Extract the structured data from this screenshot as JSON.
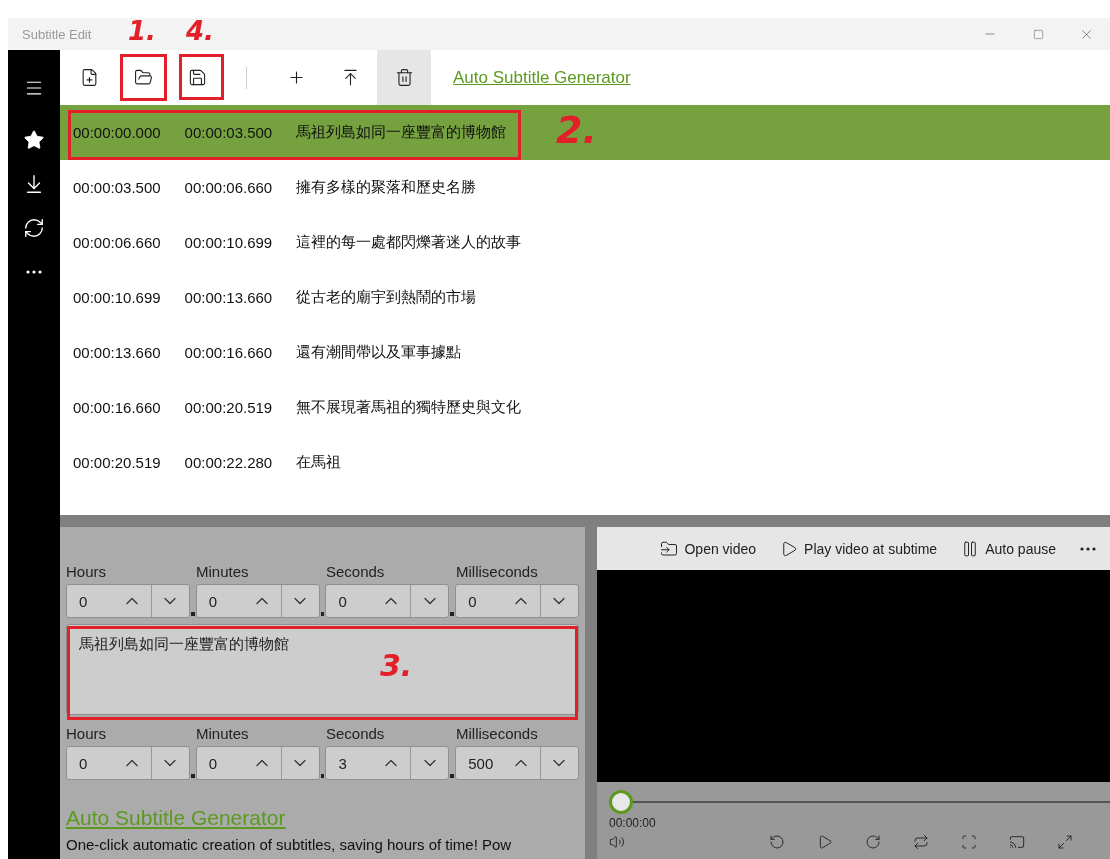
{
  "window": {
    "title": "Subtitle Edit"
  },
  "sidebar": {
    "items": [
      {
        "kind": "favorites"
      },
      {
        "kind": "download"
      },
      {
        "kind": "sync"
      },
      {
        "kind": "more"
      }
    ]
  },
  "toolbar": {
    "buttons": [
      {
        "kind": "new",
        "hovered": false
      },
      {
        "kind": "open",
        "hovered": false
      },
      {
        "kind": "save",
        "hovered": false
      },
      {
        "kind": "separator"
      },
      {
        "kind": "add",
        "hovered": false
      },
      {
        "kind": "insert-top",
        "hovered": false
      },
      {
        "kind": "delete",
        "hovered": true
      }
    ],
    "link": "Auto Subtitle Generator"
  },
  "subtitles": [
    {
      "start": "00:00:00.000",
      "end": "00:00:03.500",
      "text": "馬祖列島如同一座豐富的博物館",
      "selected": true
    },
    {
      "start": "00:00:03.500",
      "end": "00:00:06.660",
      "text": "擁有多樣的聚落和歷史名勝",
      "selected": false
    },
    {
      "start": "00:00:06.660",
      "end": "00:00:10.699",
      "text": "這裡的每一處都閃爍著迷人的故事",
      "selected": false
    },
    {
      "start": "00:00:10.699",
      "end": "00:00:13.660",
      "text": "從古老的廟宇到熱鬧的市場",
      "selected": false
    },
    {
      "start": "00:00:13.660",
      "end": "00:00:16.660",
      "text": "還有潮間帶以及軍事據點",
      "selected": false
    },
    {
      "start": "00:00:16.660",
      "end": "00:00:20.519",
      "text": "無不展現著馬祖的獨特歷史與文化",
      "selected": false
    },
    {
      "start": "00:00:20.519",
      "end": "00:00:22.280",
      "text": "在馬祖",
      "selected": false
    }
  ],
  "editor": {
    "start_time": [
      {
        "label": "Hours",
        "value": "0"
      },
      {
        "label": "Minutes",
        "value": "0"
      },
      {
        "label": "Seconds",
        "value": "0"
      },
      {
        "label": "Milliseconds",
        "value": "0"
      }
    ],
    "text": "馬祖列島如同一座豐富的博物館",
    "end_time": [
      {
        "label": "Hours",
        "value": "0"
      },
      {
        "label": "Minutes",
        "value": "0"
      },
      {
        "label": "Seconds",
        "value": "3"
      },
      {
        "label": "Milliseconds",
        "value": "500"
      }
    ]
  },
  "promo": {
    "link": "Auto Subtitle Generator",
    "description": "One-click automatic creation of subtitles, saving hours of time! Pow"
  },
  "video": {
    "toolbar": [
      {
        "kind": "open",
        "label": "Open video"
      },
      {
        "kind": "play",
        "label": "Play video at subtime"
      },
      {
        "kind": "pause",
        "label": "Auto pause"
      },
      {
        "kind": "more"
      }
    ],
    "position": {
      "level": 0,
      "time": "00:00:00"
    },
    "controls": [
      {
        "kind": "volume"
      },
      {
        "kind": "back"
      },
      {
        "kind": "play"
      },
      {
        "kind": "forward"
      },
      {
        "kind": "replay"
      },
      {
        "kind": "fit"
      },
      {
        "kind": "cast"
      },
      {
        "kind": "fullscreen"
      }
    ]
  },
  "annotations": [
    {
      "label": "1."
    },
    {
      "label": "4."
    },
    {
      "label": "2."
    },
    {
      "label": "3."
    }
  ]
}
